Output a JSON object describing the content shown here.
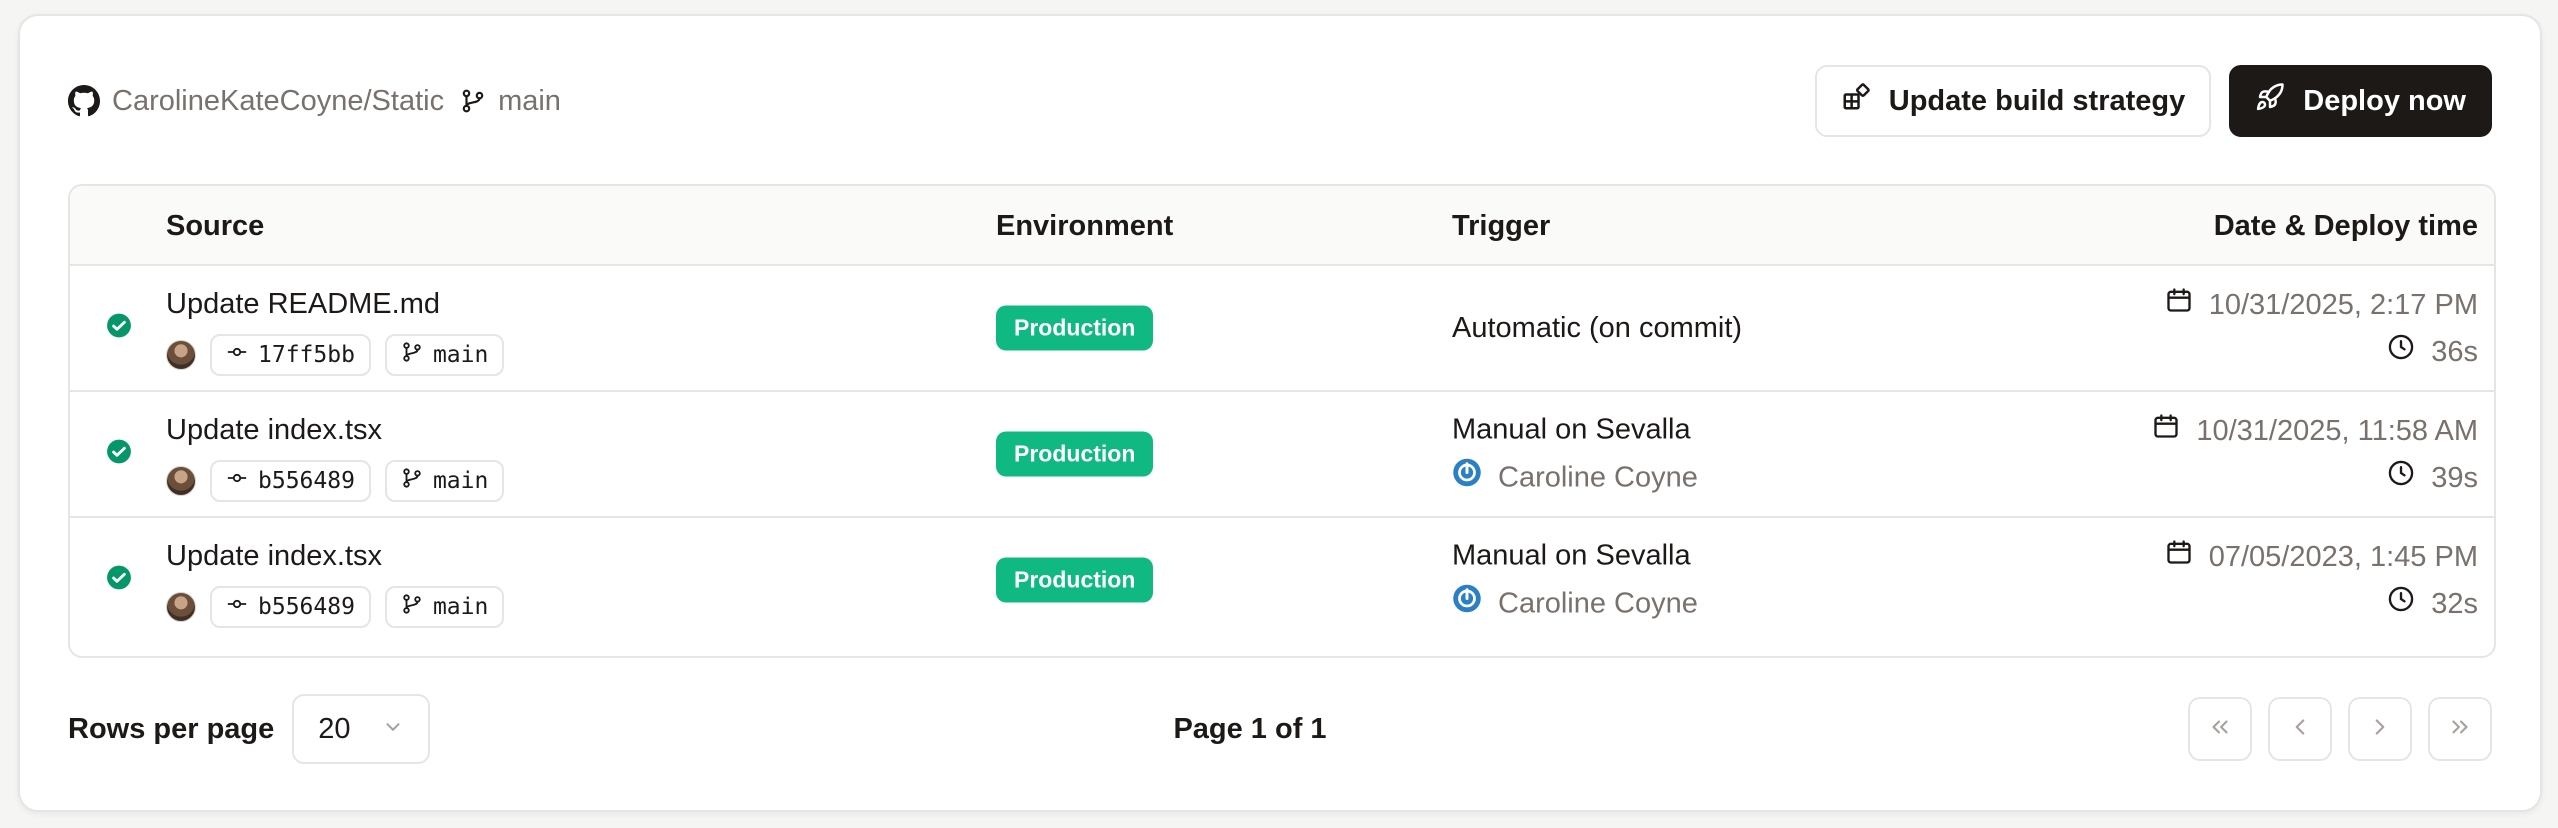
{
  "repo": {
    "name": "CarolineKateCoyne/Static",
    "branch": "main"
  },
  "actions": {
    "update_strategy": "Update build strategy",
    "deploy": "Deploy now"
  },
  "columns": {
    "source": "Source",
    "environment": "Environment",
    "trigger": "Trigger",
    "date": "Date & Deploy time"
  },
  "rows": [
    {
      "title": "Update README.md",
      "commit": "17ff5bb",
      "branch": "main",
      "environment": "Production",
      "trigger": "Automatic (on commit)",
      "triggered_by": "",
      "date": "10/31/2025, 2:17 PM",
      "duration": "36s"
    },
    {
      "title": "Update index.tsx",
      "commit": "b556489",
      "branch": "main",
      "environment": "Production",
      "trigger": "Manual on Sevalla",
      "triggered_by": "Caroline Coyne",
      "date": "10/31/2025, 11:58 AM",
      "duration": "39s"
    },
    {
      "title": "Update index.tsx",
      "commit": "b556489",
      "branch": "main",
      "environment": "Production",
      "trigger": "Manual on Sevalla",
      "triggered_by": "Caroline Coyne",
      "date": "07/05/2023, 1:45 PM",
      "duration": "32s"
    }
  ],
  "footer": {
    "rows_per_page_label": "Rows per page",
    "rows_per_page": "20",
    "page_info": "Page 1 of 1"
  },
  "colors": {
    "success": "#059669",
    "badge": "#10b981",
    "dark": "#1c1917",
    "muted": "#78716c"
  },
  "icons": [
    "github-icon",
    "git-branch-icon",
    "layout-icon",
    "rocket-icon",
    "check-circle-icon",
    "git-commit-icon",
    "calendar-icon",
    "clock-icon",
    "sevalla-icon",
    "chevron-down-icon",
    "chevrons-left-icon",
    "chevron-left-icon",
    "chevron-right-icon",
    "chevrons-right-icon"
  ]
}
